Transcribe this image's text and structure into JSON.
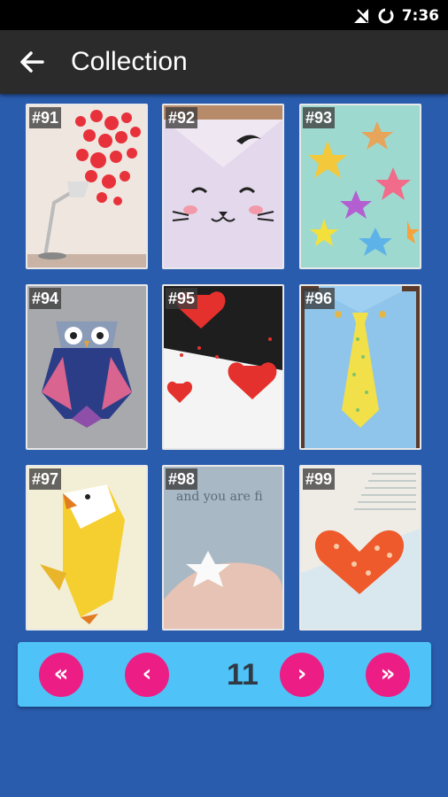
{
  "status": {
    "time": "7:36"
  },
  "appbar": {
    "title": "Collection",
    "back_icon": "arrow-back-icon"
  },
  "items": [
    {
      "label": "#91"
    },
    {
      "label": "#92"
    },
    {
      "label": "#93"
    },
    {
      "label": "#94"
    },
    {
      "label": "#95"
    },
    {
      "label": "#96"
    },
    {
      "label": "#97"
    },
    {
      "label": "#98"
    },
    {
      "label": "#99"
    }
  ],
  "pager": {
    "first_label": "«",
    "prev_label": "‹",
    "page": "11",
    "next_label": "›",
    "last_label": "»"
  },
  "colors": {
    "background": "#2a5cae",
    "appbar": "#2b2b2b",
    "pager": "#4fc3f7",
    "button": "#ec1e86"
  }
}
